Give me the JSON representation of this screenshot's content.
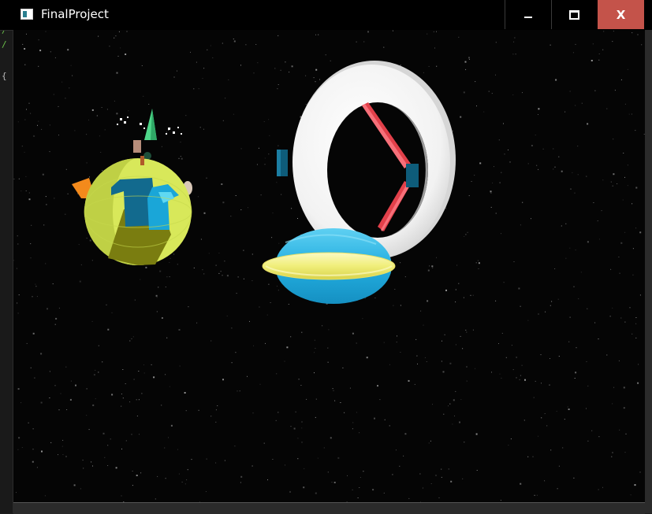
{
  "window": {
    "title": "FinalProject",
    "icon": "app-window-icon",
    "controls": {
      "minimize_icon": "minimize-icon",
      "maximize_icon": "maximize-icon",
      "close_label": "X"
    },
    "colors": {
      "titlebar": "#000000",
      "close_button": "#c4534a",
      "viewport_background": "#050505"
    }
  },
  "scene": {
    "objects": [
      {
        "name": "planet",
        "colors": {
          "body": "#d8e85a",
          "shade": "#7a7d10",
          "continent": "#1aa6d8"
        }
      },
      {
        "name": "ring-station",
        "colors": {
          "ring": "#f4f4f4",
          "spokes": "#e2404a",
          "joints": "#0e5c7a"
        }
      },
      {
        "name": "saucer",
        "colors": {
          "dome": "#2ab6e6",
          "rim": "#f0ee7a"
        }
      }
    ]
  }
}
